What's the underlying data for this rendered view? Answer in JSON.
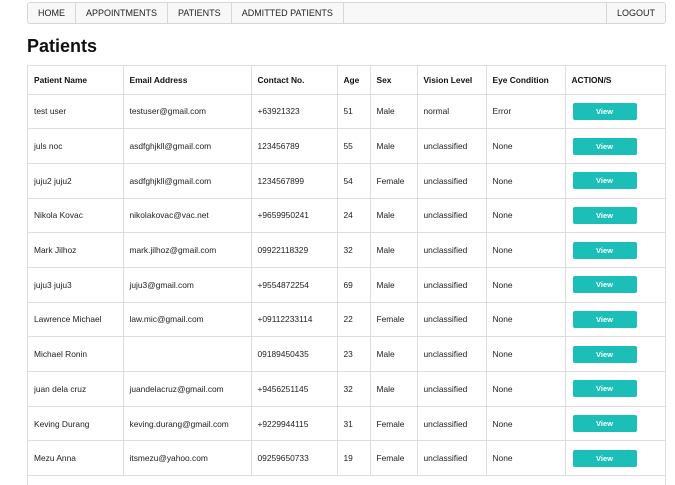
{
  "nav": {
    "home": "HOME",
    "appointments": "APPOINTMENTS",
    "patients": "PATIENTS",
    "admitted": "ADMITTED PATIENTS",
    "logout": "LOGOUT"
  },
  "page": {
    "title": "Patients"
  },
  "table": {
    "headers": [
      "Patient Name",
      "Email Address",
      "Contact No.",
      "Age",
      "Sex",
      "Vision Level",
      "Eye Condition",
      "ACTION/S"
    ],
    "rows": [
      [
        "test user",
        "testuser@gmail.com",
        "+63921323",
        "51",
        "Male",
        "normal",
        "Error",
        "View"
      ],
      [
        "juls noc",
        "asdfghjkll@gmail.com",
        "123456789",
        "55",
        "Male",
        "unclassified",
        "None",
        "View"
      ],
      [
        "juju2 juju2",
        "asdfghjkll@gmail.com",
        "1234567899",
        "54",
        "Female",
        "unclassified",
        "None",
        "View"
      ],
      [
        "Nikola Kovac",
        "nikolakovac@vac.net",
        "+9659950241",
        "24",
        "Male",
        "unclassified",
        "None",
        "View"
      ],
      [
        "Mark Jilhoz",
        "mark.jilhoz@gmail.com",
        "09922118329",
        "32",
        "Male",
        "unclassified",
        "None",
        "View"
      ],
      [
        "juju3 juju3",
        "juju3@gmail.com",
        "+9554872254",
        "69",
        "Male",
        "unclassified",
        "None",
        "View"
      ],
      [
        "Lawrence Michael",
        "law.mic@gmail.com",
        "+09112233114",
        "22",
        "Female",
        "unclassified",
        "None",
        "View"
      ],
      [
        "Michael Ronin",
        "",
        "09189450435",
        "23",
        "Male",
        "unclassified",
        "None",
        "View"
      ],
      [
        "juan dela cruz",
        "juandelacruz@gmail.com",
        "+9456251145",
        "32",
        "Male",
        "unclassified",
        "None",
        "View"
      ],
      [
        "Keving Durang",
        "keving.durang@gmail.com",
        "+9229944115",
        "31",
        "Female",
        "unclassified",
        "None",
        "View"
      ],
      [
        "Mezu Anna",
        "itsmezu@yahoo.com",
        "09259650733",
        "19",
        "Female",
        "unclassified",
        "None",
        "View"
      ]
    ]
  },
  "colors": {
    "view_button": "#1bbfb7",
    "border": "#dedede"
  }
}
